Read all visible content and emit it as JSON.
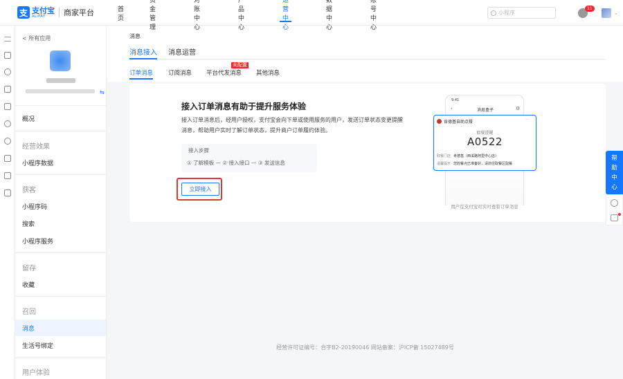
{
  "brand": {
    "logo_glyph": "支",
    "name_cn": "支付宝",
    "name_en": "ALIPAY",
    "title": "商家平台",
    "color": "#1677ff"
  },
  "topnav": [
    {
      "label": "首页"
    },
    {
      "label": "资金管理"
    },
    {
      "label": "对账中心"
    },
    {
      "label": "产品中心"
    },
    {
      "label": "运营中心",
      "active": true
    },
    {
      "label": "数据中心"
    },
    {
      "label": "账号中心"
    }
  ],
  "search": {
    "placeholder": "小程序"
  },
  "notifications": {
    "count": "11"
  },
  "sidebar": {
    "back_label": "< 所有应用",
    "switch_glyph": "⇆",
    "groups": {
      "overview": "概况",
      "operation": "经营效果",
      "mini_data": "小程序数据",
      "acquire": "获客",
      "mini_code": "小程序码",
      "search": "搜索",
      "mini_service": "小程序服务",
      "retain": "留存",
      "favorite": "收藏",
      "recall": "召回",
      "message": "消息",
      "life_bind": "生活号绑定",
      "user_exp": "用户体验"
    }
  },
  "main": {
    "breadcrumb": "消息",
    "tabs": [
      {
        "label": "消息接入",
        "active": true
      },
      {
        "label": "消息运营"
      }
    ],
    "subtabs": [
      {
        "label": "订单消息",
        "active": true
      },
      {
        "label": "订阅消息"
      },
      {
        "label": "平台代发消息",
        "badge": "未配置"
      },
      {
        "label": "其他消息"
      }
    ],
    "card": {
      "title": "接入订单消息有助于提升服务体验",
      "desc": "接入订单消息后，经用户授权，支付宝会向下单或使用服务的用户，发送订单状态变更提醒消息，帮助用户实时了解订单状态，提升商户订单履约体验。",
      "steps_title": "接入步骤",
      "steps": "① 了解模板  —  ② 接入接口  —  ③ 发送信息",
      "cta": "立即接入"
    },
    "phone": {
      "status_time": "9:41",
      "title": "消息盒子",
      "shop": "肯德基自助点餐",
      "code_label": "取餐提醒",
      "code": "A0522",
      "row1_label": "取餐门店",
      "row1_value": "肯德基（西溪路阿里中心店）",
      "row2_label": "温馨提示",
      "row2_value": "您的餐点已准备好，请前往取餐区取餐",
      "caption": "用户在支付宝可实时查看订单消息"
    }
  },
  "footer": "经营许可证编号：合字B2-20190046 网站备案：沪ICP备 15027489号",
  "help": {
    "label": "帮助中心"
  }
}
